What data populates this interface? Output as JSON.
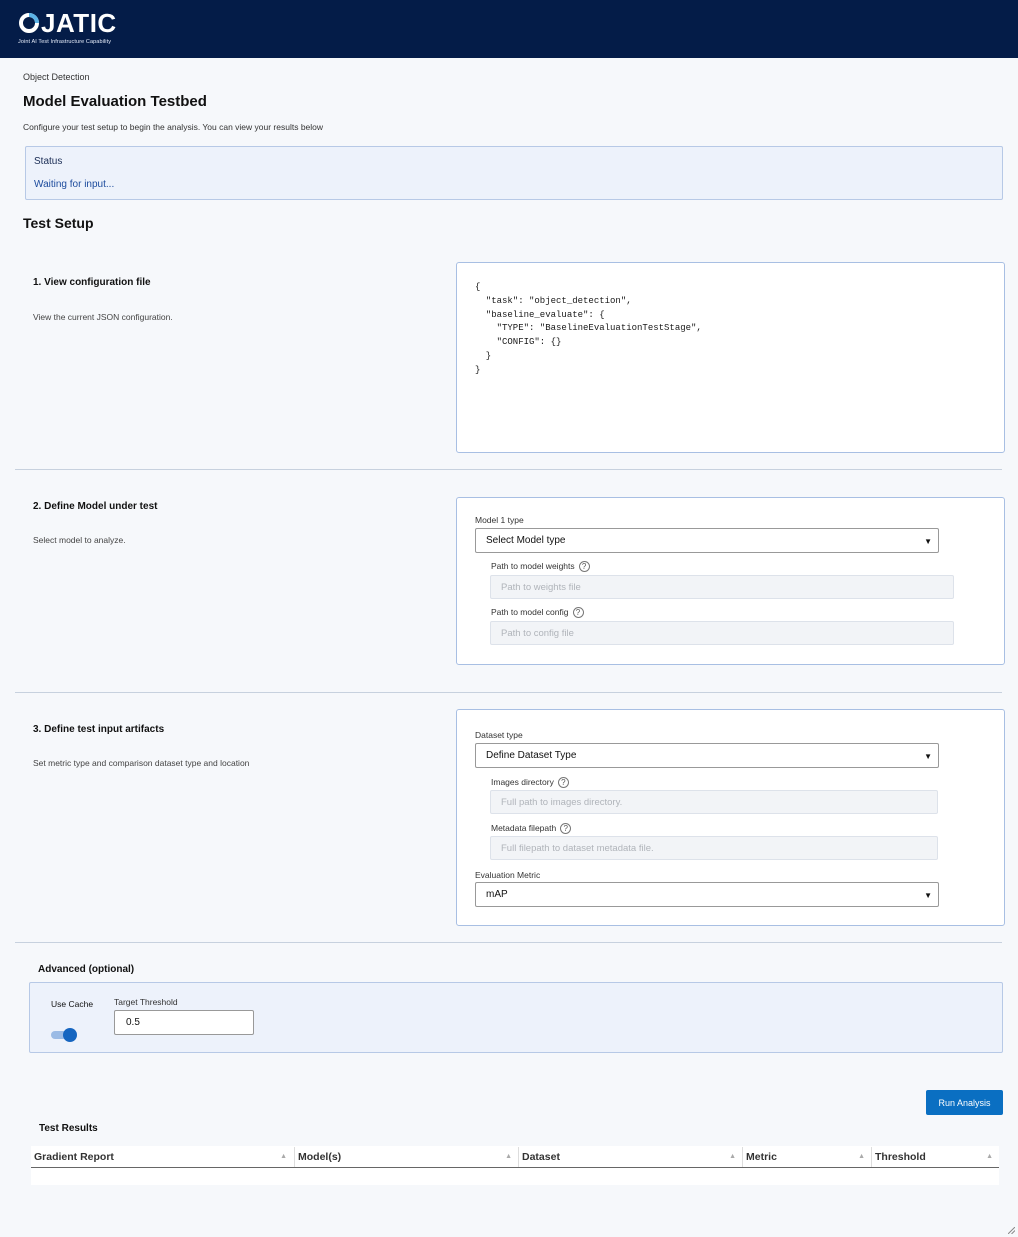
{
  "brand": {
    "name": "JATIC",
    "tagline": "Joint AI Test Infrastructure Capability",
    "color": "#041c48"
  },
  "breadcrumb": "Object Detection",
  "page_title": "Model Evaluation Testbed",
  "intro": "Configure your test setup to begin the analysis. You can view your results below",
  "status": {
    "title": "Status",
    "message": "Waiting for input..."
  },
  "section_title": "Test Setup",
  "steps": [
    {
      "title": "1. View configuration file",
      "desc": "View the current JSON configuration.",
      "config_json": "{\n  \"task\": \"object_detection\",\n  \"baseline_evaluate\": {\n    \"TYPE\": \"BaselineEvaluationTestStage\",\n    \"CONFIG\": {}\n  }\n}"
    },
    {
      "title": "2. Define Model under test",
      "desc": "Select model to analyze.",
      "model_type_label": "Model 1 type",
      "model_type_value": "Select Model type",
      "weights_label": "Path to model weights",
      "weights_placeholder": "Path to weights file",
      "config_label": "Path to model config",
      "config_placeholder": "Path to config file"
    },
    {
      "title": "3. Define test input artifacts",
      "desc": "Set metric type and comparison dataset type and location",
      "dataset_type_label": "Dataset type",
      "dataset_type_value": "Define Dataset Type",
      "images_label": "Images directory",
      "images_placeholder": "Full path to images directory.",
      "metadata_label": "Metadata filepath",
      "metadata_placeholder": "Full filepath to dataset metadata file.",
      "metric_label": "Evaluation Metric",
      "metric_value": "mAP"
    }
  ],
  "advanced": {
    "title": "Advanced (optional)",
    "use_cache_label": "Use Cache",
    "use_cache": true,
    "threshold_label": "Target Threshold",
    "threshold_value": "0.5"
  },
  "run_button": "Run Analysis",
  "results": {
    "title": "Test Results",
    "columns": [
      "Gradient Report",
      "Model(s)",
      "Dataset",
      "Metric",
      "Threshold"
    ]
  },
  "icons": {
    "help": "question-circle-icon",
    "caret": "caret-down-icon",
    "sort": "sort-asc-icon"
  }
}
